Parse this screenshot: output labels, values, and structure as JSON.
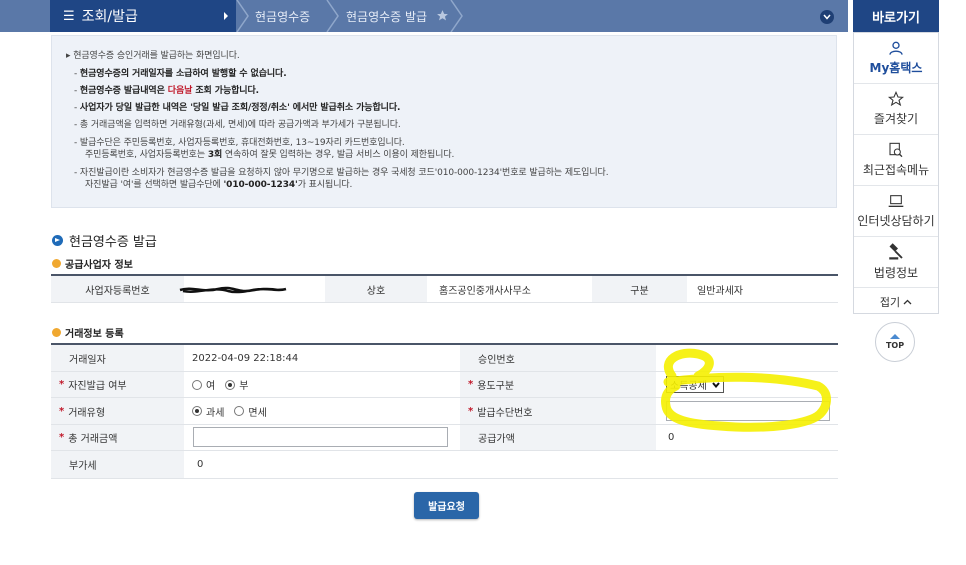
{
  "topbar": {
    "menu_title": "조회/발급",
    "breadcrumb_1": "현금영수증",
    "breadcrumb_2": "현금영수증 발급"
  },
  "sidebar": {
    "header": "바로가기",
    "items": [
      {
        "label": "My홈택스",
        "icon": "person-icon"
      },
      {
        "label": "즐겨찾기",
        "icon": "star-icon"
      },
      {
        "label": "최근접속메뉴",
        "icon": "recent-menu-icon"
      },
      {
        "label": "인터넷상담하기",
        "icon": "laptop-icon"
      },
      {
        "label": "법령정보",
        "icon": "gavel-icon"
      }
    ],
    "fold_label": "접기",
    "top_label": "TOP"
  },
  "info": {
    "line0": "현금영수증 승인거래를 발급하는 화면입니다.",
    "line1": "현금영수증의 거래일자를 소급하여 발행할 수 없습니다.",
    "line2_a": "현금영수증 발급내역은 ",
    "line2_red": "다음날",
    "line2_b": " 조회 가능합니다.",
    "line3": "사업자가 당일 발급한 내역은 '당일 발급 조회/정정/취소' 에서만 발급취소 가능합니다.",
    "line4": "총 거래금액을 입력하면 거래유형(과세, 면세)에 따라 공급가액과 부가세가 구분됩니다.",
    "line5a": "발급수단은 주민등록번호, 사업자등록번호, 휴대전화번호, 13~19자리 카드번호입니다.",
    "line5b_a": "주민등록번호, 사업자등록번호는 ",
    "line5b_bold": "3회",
    "line5b_b": " 연속하여 잘못 입력하는 경우, 발급 서비스 이용이 제한됩니다.",
    "line6a": "자진발급이란 소비자가 현금영수증 발급을 요청하지 않아 무기명으로 발급하는 경우 국세청 코드'010-000-1234'번호로 발급하는 제도입니다.",
    "line6b_a": "자진발급 '여'를 선택하면 발급수단에 ",
    "line6b_bold": "'010-000-1234'",
    "line6b_b": "가 표시됩니다."
  },
  "section": {
    "title": "현금영수증 발급",
    "supplier_title": "공급사업자 정보",
    "transaction_title": "거래정보 등록"
  },
  "supplier": {
    "bizno_label": "사업자등록번호",
    "bizno_value": "",
    "name_label": "상호",
    "name_value": "홈즈공인중개사사무소",
    "type_label": "구분",
    "type_value": "일반과세자"
  },
  "transaction": {
    "date_label": "거래일자",
    "date_value": "2022-04-09 22:18:44",
    "approval_label": "승인번호",
    "approval_value": "",
    "self_issue_label": "자진발급 여부",
    "self_issue_options": [
      "여",
      "부"
    ],
    "self_issue_selected": "부",
    "purpose_label": "용도구분",
    "purpose_value": "소득공제",
    "trade_type_label": "거래유형",
    "trade_type_options": [
      "과세",
      "면세"
    ],
    "trade_type_selected": "과세",
    "means_label": "발급수단번호",
    "means_value": "",
    "total_label": "총 거래금액",
    "total_value": "",
    "supply_label": "공급가액",
    "supply_value": "0",
    "vat_label": "부가세",
    "vat_value": "0"
  },
  "submit_label": "발급요청",
  "colors": {
    "nav_dark": "#1f4685",
    "nav_light": "#5a78a8",
    "required": "#c0182a",
    "highlight": "#f5f000"
  }
}
